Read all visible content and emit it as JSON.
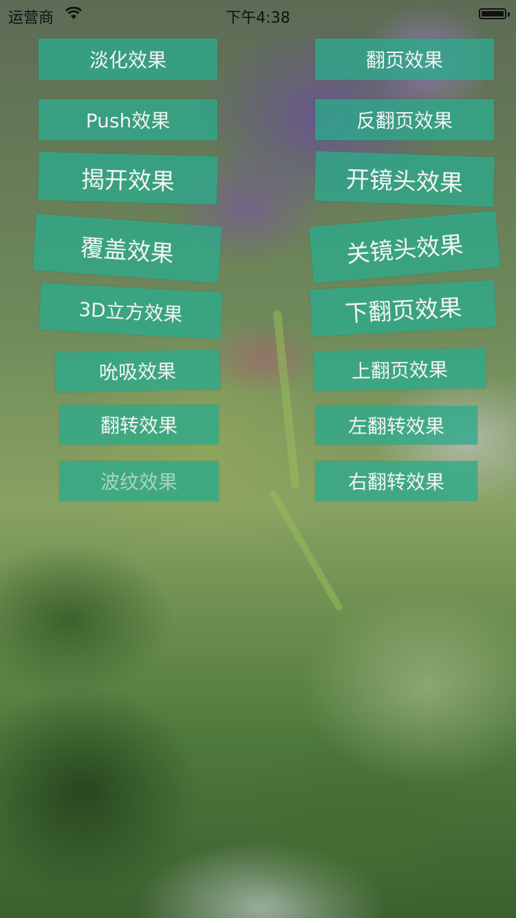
{
  "status_bar": {
    "carrier": "运营商",
    "time": "下午4:38"
  },
  "buttons": {
    "fade": "淡化效果",
    "page_curl": "翻页效果",
    "push": "Push效果",
    "reverse_page_curl": "反翻页效果",
    "reveal": "揭开效果",
    "camera_open": "开镜头效果",
    "cover": "覆盖效果",
    "camera_close": "关镜头效果",
    "cube_3d": "3D立方效果",
    "page_down": "下翻页效果",
    "suck": "吮吸效果",
    "page_up": "上翻页效果",
    "flip": "翻转效果",
    "flip_left": "左翻转效果",
    "ripple": "波纹效果",
    "flip_right": "右翻转效果"
  }
}
